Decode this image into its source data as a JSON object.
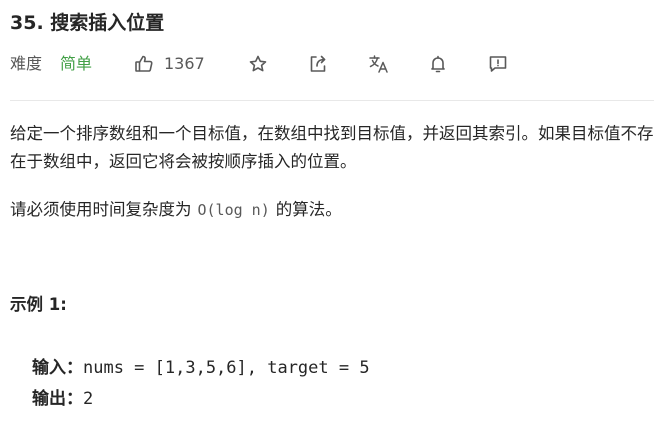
{
  "problem": {
    "title": "35. 搜索插入位置"
  },
  "toolbar": {
    "difficulty_label": "难度",
    "difficulty_value": "简单",
    "likes_count": "1367",
    "icons": [
      "thumbs-up-icon",
      "star-icon",
      "share-icon",
      "translate-icon",
      "bell-icon",
      "feedback-icon"
    ]
  },
  "description": {
    "paragraph1": "给定一个排序数组和一个目标值，在数组中找到目标值，并返回其索引。如果目标值不存在于数组中，返回它将会被按顺序插入的位置。",
    "paragraph2_prefix": "请必须使用时间复杂度为",
    "paragraph2_code": "O(log n)",
    "paragraph2_suffix": "的算法。"
  },
  "example1": {
    "heading": "示例 1:",
    "input_label": "输入：",
    "input_value": "nums = [1,3,5,6], target = 5",
    "output_label": "输出：",
    "output_value": "2"
  },
  "colors": {
    "difficulty_easy": "#43a047",
    "text_primary": "#262626",
    "text_secondary": "#595959",
    "divider": "#e8e8e8"
  }
}
